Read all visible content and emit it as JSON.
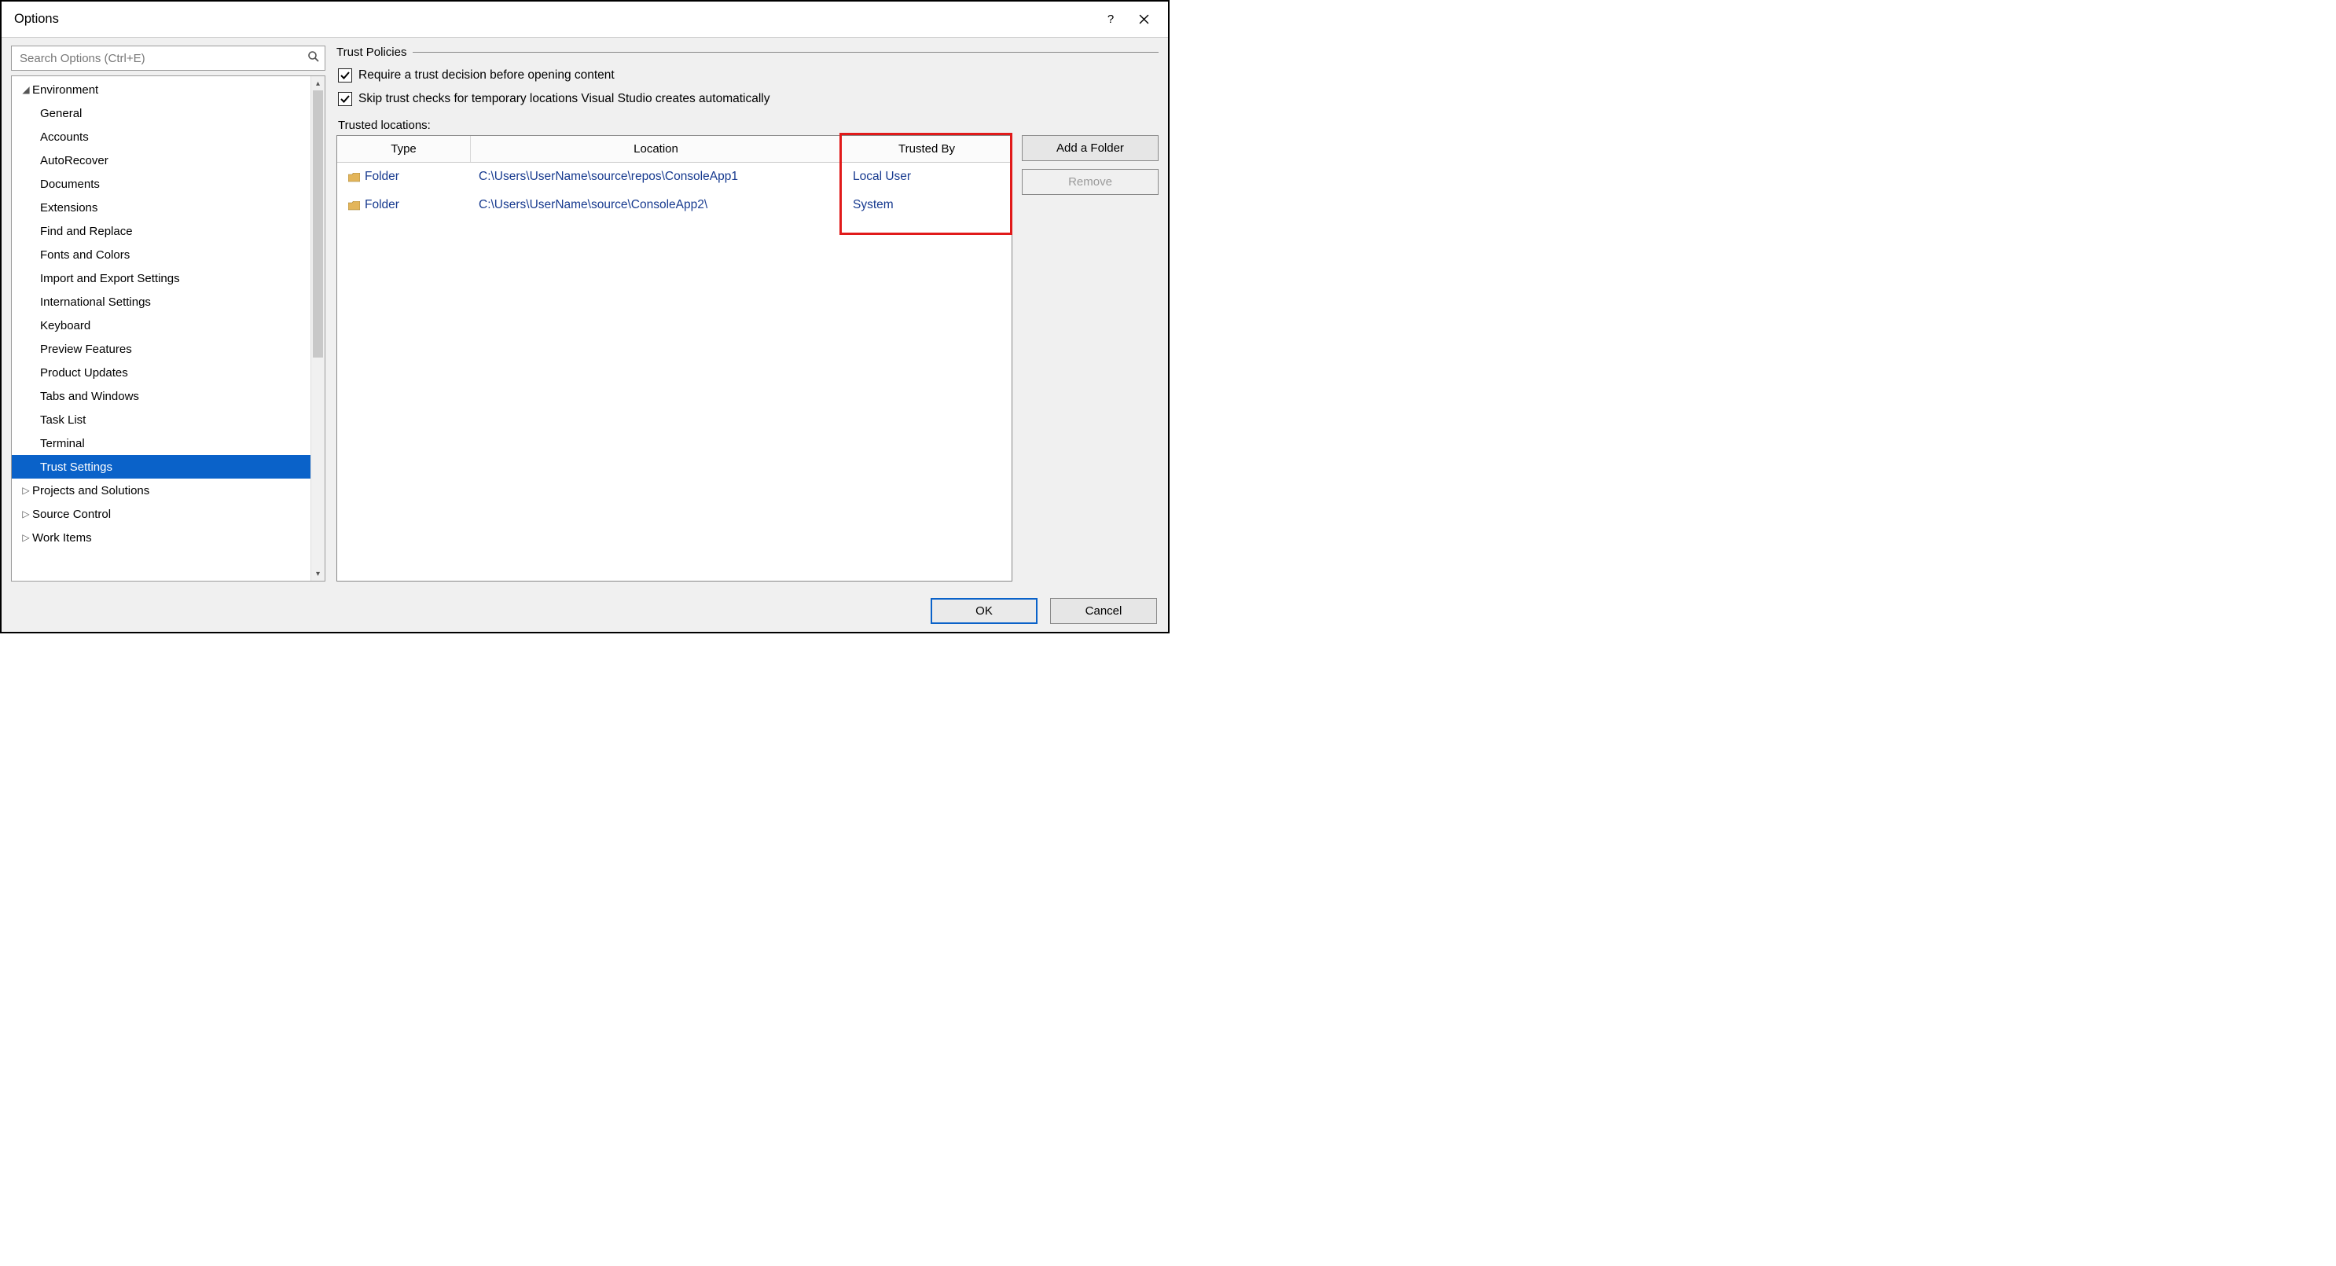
{
  "window": {
    "title": "Options"
  },
  "search": {
    "placeholder": "Search Options (Ctrl+E)"
  },
  "tree": {
    "top": {
      "label": "Environment",
      "expanded": true
    },
    "children": [
      "General",
      "Accounts",
      "AutoRecover",
      "Documents",
      "Extensions",
      "Find and Replace",
      "Fonts and Colors",
      "Import and Export Settings",
      "International Settings",
      "Keyboard",
      "Preview Features",
      "Product Updates",
      "Tabs and Windows",
      "Task List",
      "Terminal",
      "Trust Settings"
    ],
    "selected": "Trust Settings",
    "others": [
      {
        "label": "Projects and Solutions"
      },
      {
        "label": "Source Control"
      },
      {
        "label": "Work Items"
      }
    ]
  },
  "policies": {
    "header": "Trust Policies",
    "requireDecision": "Require a trust decision before opening content",
    "skipTemp": "Skip trust checks for temporary locations Visual Studio creates automatically",
    "locationsLabel": "Trusted locations:",
    "columns": {
      "type": "Type",
      "location": "Location",
      "by": "Trusted By"
    },
    "rows": [
      {
        "type": "Folder",
        "location": "C:\\Users\\UserName\\source\\repos\\ConsoleApp1",
        "by": "Local User"
      },
      {
        "type": "Folder",
        "location": "C:\\Users\\UserName\\source\\ConsoleApp2\\",
        "by": "System"
      }
    ],
    "addFolder": "Add a Folder",
    "remove": "Remove"
  },
  "footer": {
    "ok": "OK",
    "cancel": "Cancel"
  }
}
